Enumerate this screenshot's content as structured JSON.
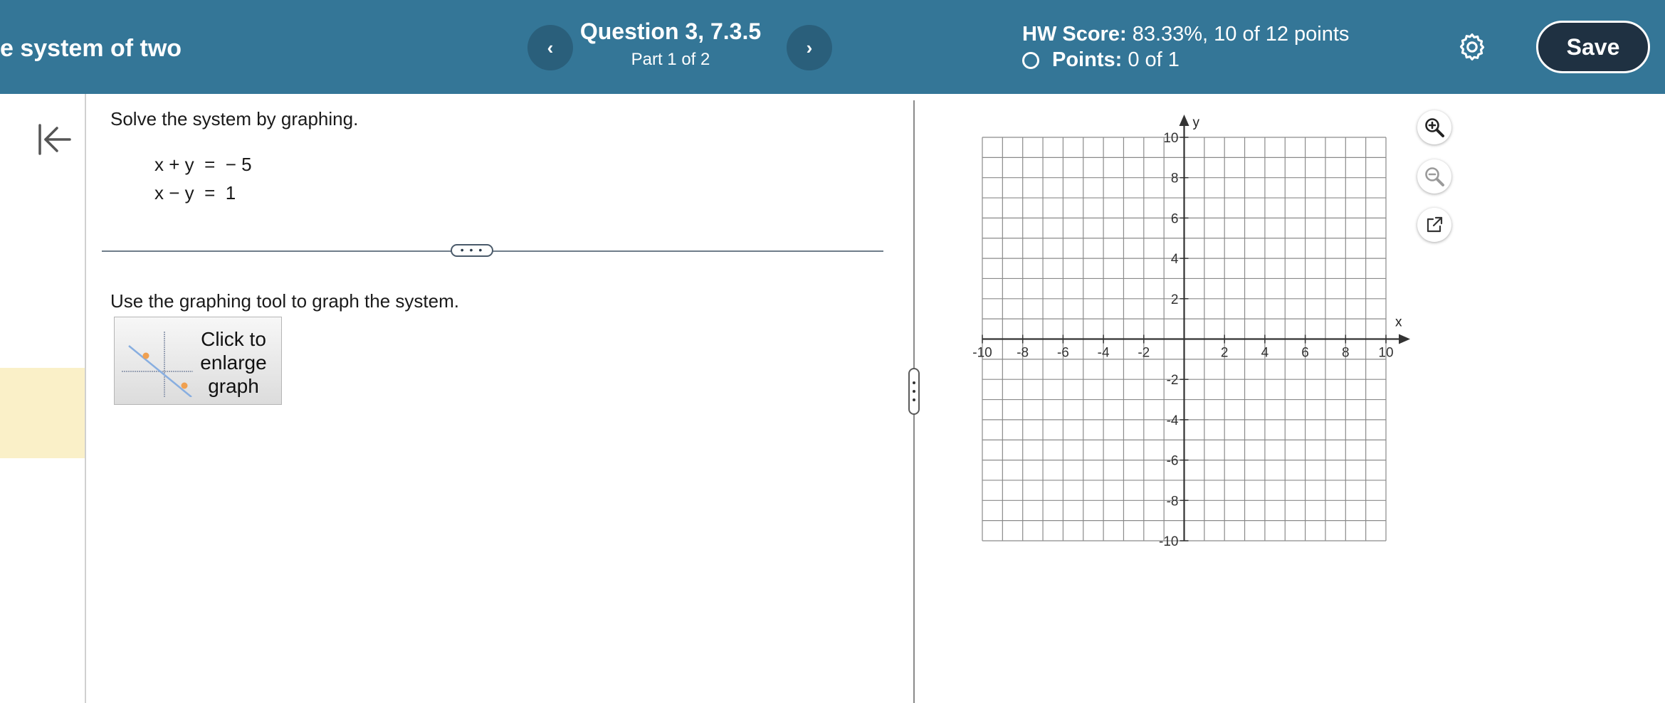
{
  "header": {
    "title": "e system of two",
    "prev_label": "‹",
    "next_label": "›",
    "question_title": "Question 3, 7.3.5",
    "question_part": "Part 1 of 2",
    "hw_score_label": "HW Score:",
    "hw_score_value": "83.33%, 10 of 12 points",
    "points_label": "Points:",
    "points_value": "0 of 1",
    "save_label": "Save",
    "settings_icon": "gear-icon",
    "bg_color": "#347697"
  },
  "question": {
    "prompt": "Solve the system by graphing.",
    "equations": [
      "x + y  =  − 5",
      "x − y  =  1"
    ],
    "more_label": "• • •",
    "instruction": "Use the graphing tool to graph the system.",
    "enlarge_label": "Click to enlarge graph"
  },
  "graph": {
    "x_label": "x",
    "y_label": "y",
    "x_range": [
      -10,
      10
    ],
    "y_range": [
      -10,
      10
    ],
    "minor_step": 1,
    "tick_labels_x": [
      "-10",
      "-8",
      "-6",
      "-4",
      "-2",
      "2",
      "4",
      "6",
      "8",
      "10"
    ],
    "tick_labels_y": [
      "10",
      "8",
      "6",
      "4",
      "2",
      "-2",
      "-4",
      "-6",
      "-8",
      "-10"
    ],
    "tools": [
      "zoom-in-icon",
      "zoom-out-icon",
      "popout-icon"
    ]
  }
}
